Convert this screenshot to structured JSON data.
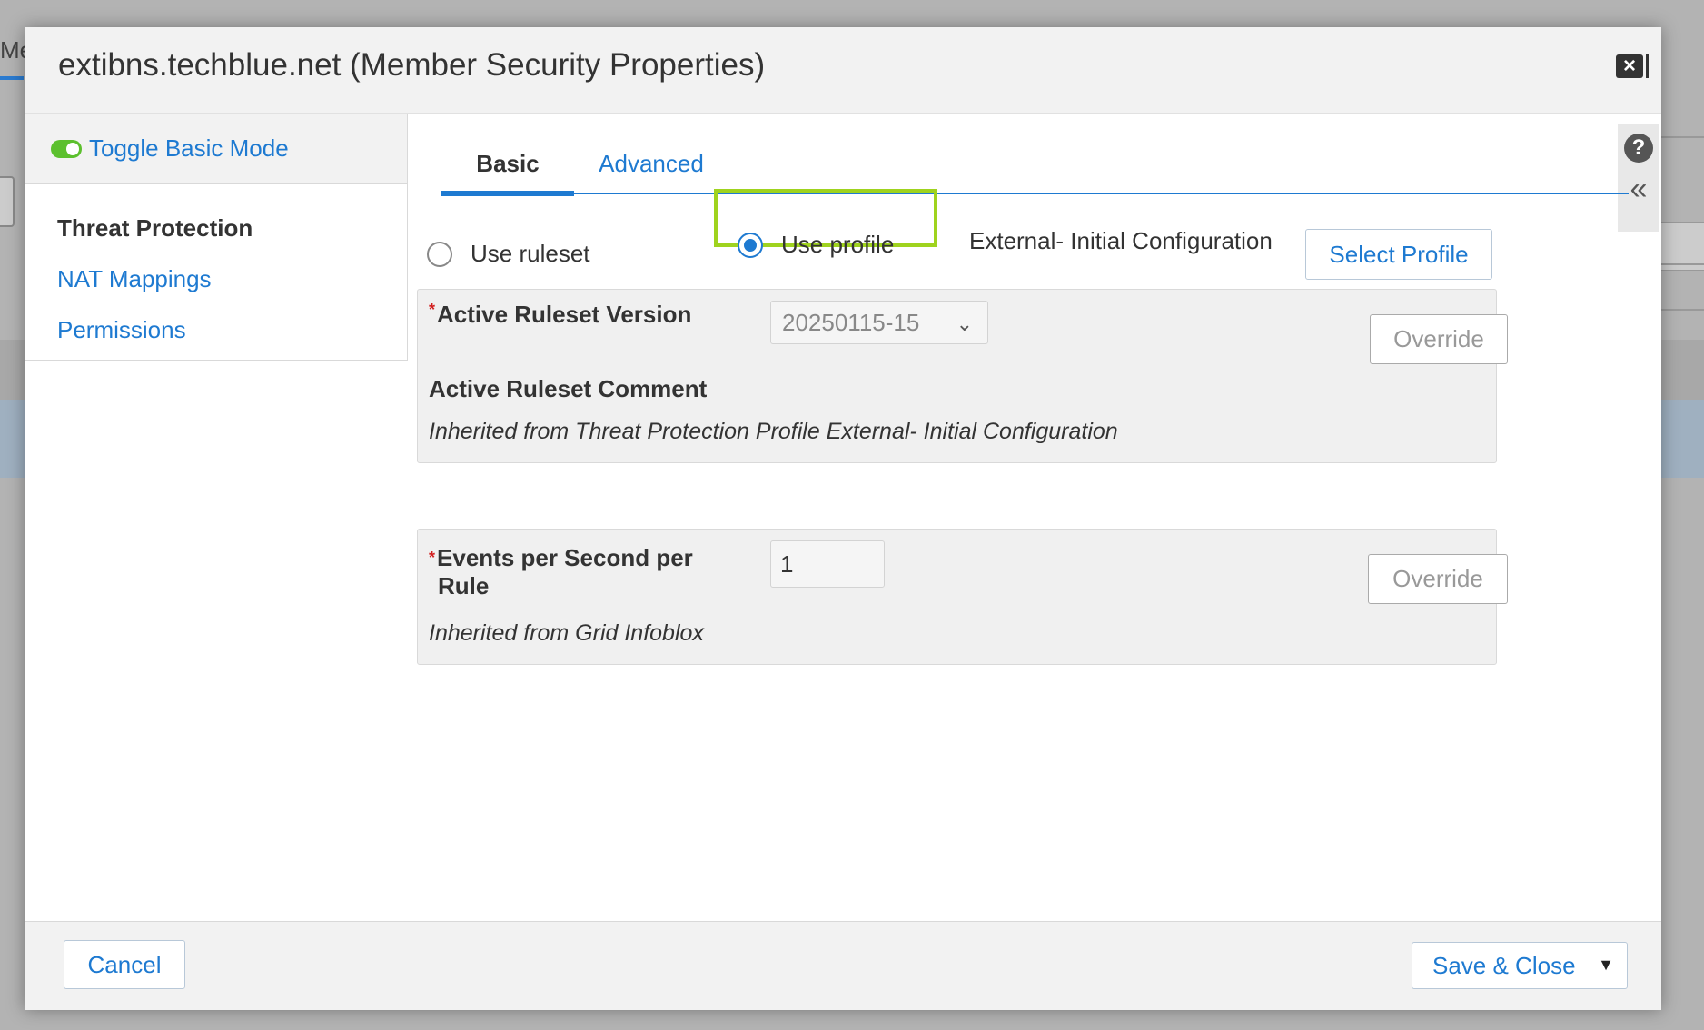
{
  "background": {
    "left_fragment": "Mer"
  },
  "dialog": {
    "title": "extibns.techblue.net (Member Security Properties)",
    "close_label": "×"
  },
  "sidebar": {
    "toggle_label": "Toggle Basic Mode",
    "items": [
      {
        "label": "Threat Protection",
        "active": true
      },
      {
        "label": "NAT Mappings",
        "active": false
      },
      {
        "label": "Permissions",
        "active": false
      }
    ]
  },
  "help": {
    "help_glyph": "?",
    "collapse_glyph": "«"
  },
  "tabs": [
    {
      "label": "Basic",
      "active": true
    },
    {
      "label": "Advanced",
      "active": false
    }
  ],
  "mode": {
    "use_ruleset_label": "Use ruleset",
    "use_profile_label": "Use profile",
    "selected": "use_profile",
    "profile_name": "External- Initial Configuration",
    "select_profile_label": "Select Profile"
  },
  "ruleset_panel": {
    "version_label": "Active Ruleset Version",
    "version_value": "20250115-15",
    "comment_label": "Active Ruleset Comment",
    "inherited_text": "Inherited from Threat Protection Profile External- Initial Configuration",
    "override_label": "Override"
  },
  "events_panel": {
    "label_line1": "Events per Second per",
    "label_line2": "Rule",
    "value": "1",
    "inherited_text": "Inherited from Grid Infoblox",
    "override_label": "Override"
  },
  "footer": {
    "cancel_label": "Cancel",
    "save_label": "Save & Close"
  },
  "colors": {
    "accent": "#1e7ad1",
    "highlight_border": "#9fd31e",
    "toggle_on": "#5cc02e",
    "required": "#d21f1f"
  }
}
